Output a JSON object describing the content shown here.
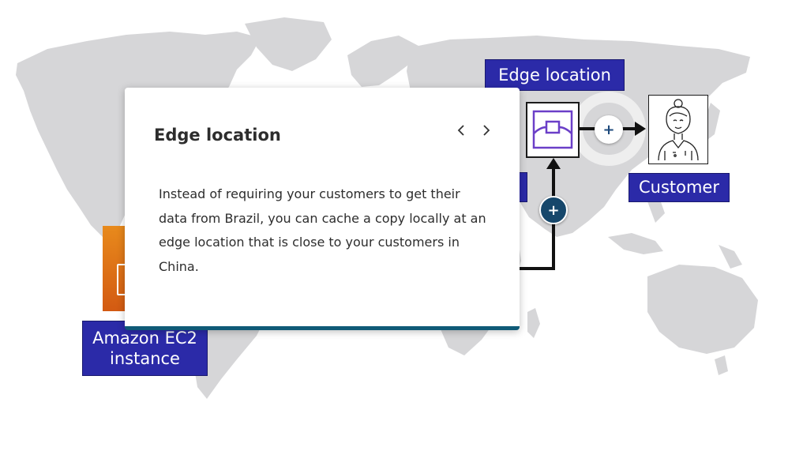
{
  "diagram": {
    "labels": {
      "edge_location": "Edge location",
      "customer": "Customer",
      "ec2_line1": "Amazon EC2",
      "ec2_line2": "instance"
    },
    "icons": {
      "edge_location": "cloudfront-edge-location-icon",
      "customer": "customer-person-icon",
      "ec2": "ec2-instance-icon",
      "hotspot": "plus-icon"
    },
    "colors": {
      "label_bg": "#2b2aa8",
      "ec2_orange": "#e07a1a",
      "hotspot_dark": "#16476b",
      "map_gray": "#d6d6d8",
      "card_accent": "#0f5a77",
      "edge_purple": "#6b3fc8"
    }
  },
  "card": {
    "title": "Edge location",
    "body": "Instead of requiring your customers to get their data from Brazil, you can cache a copy locally at an edge location that is close to your customers in China.",
    "nav_prev": "‹",
    "nav_next": "›"
  }
}
